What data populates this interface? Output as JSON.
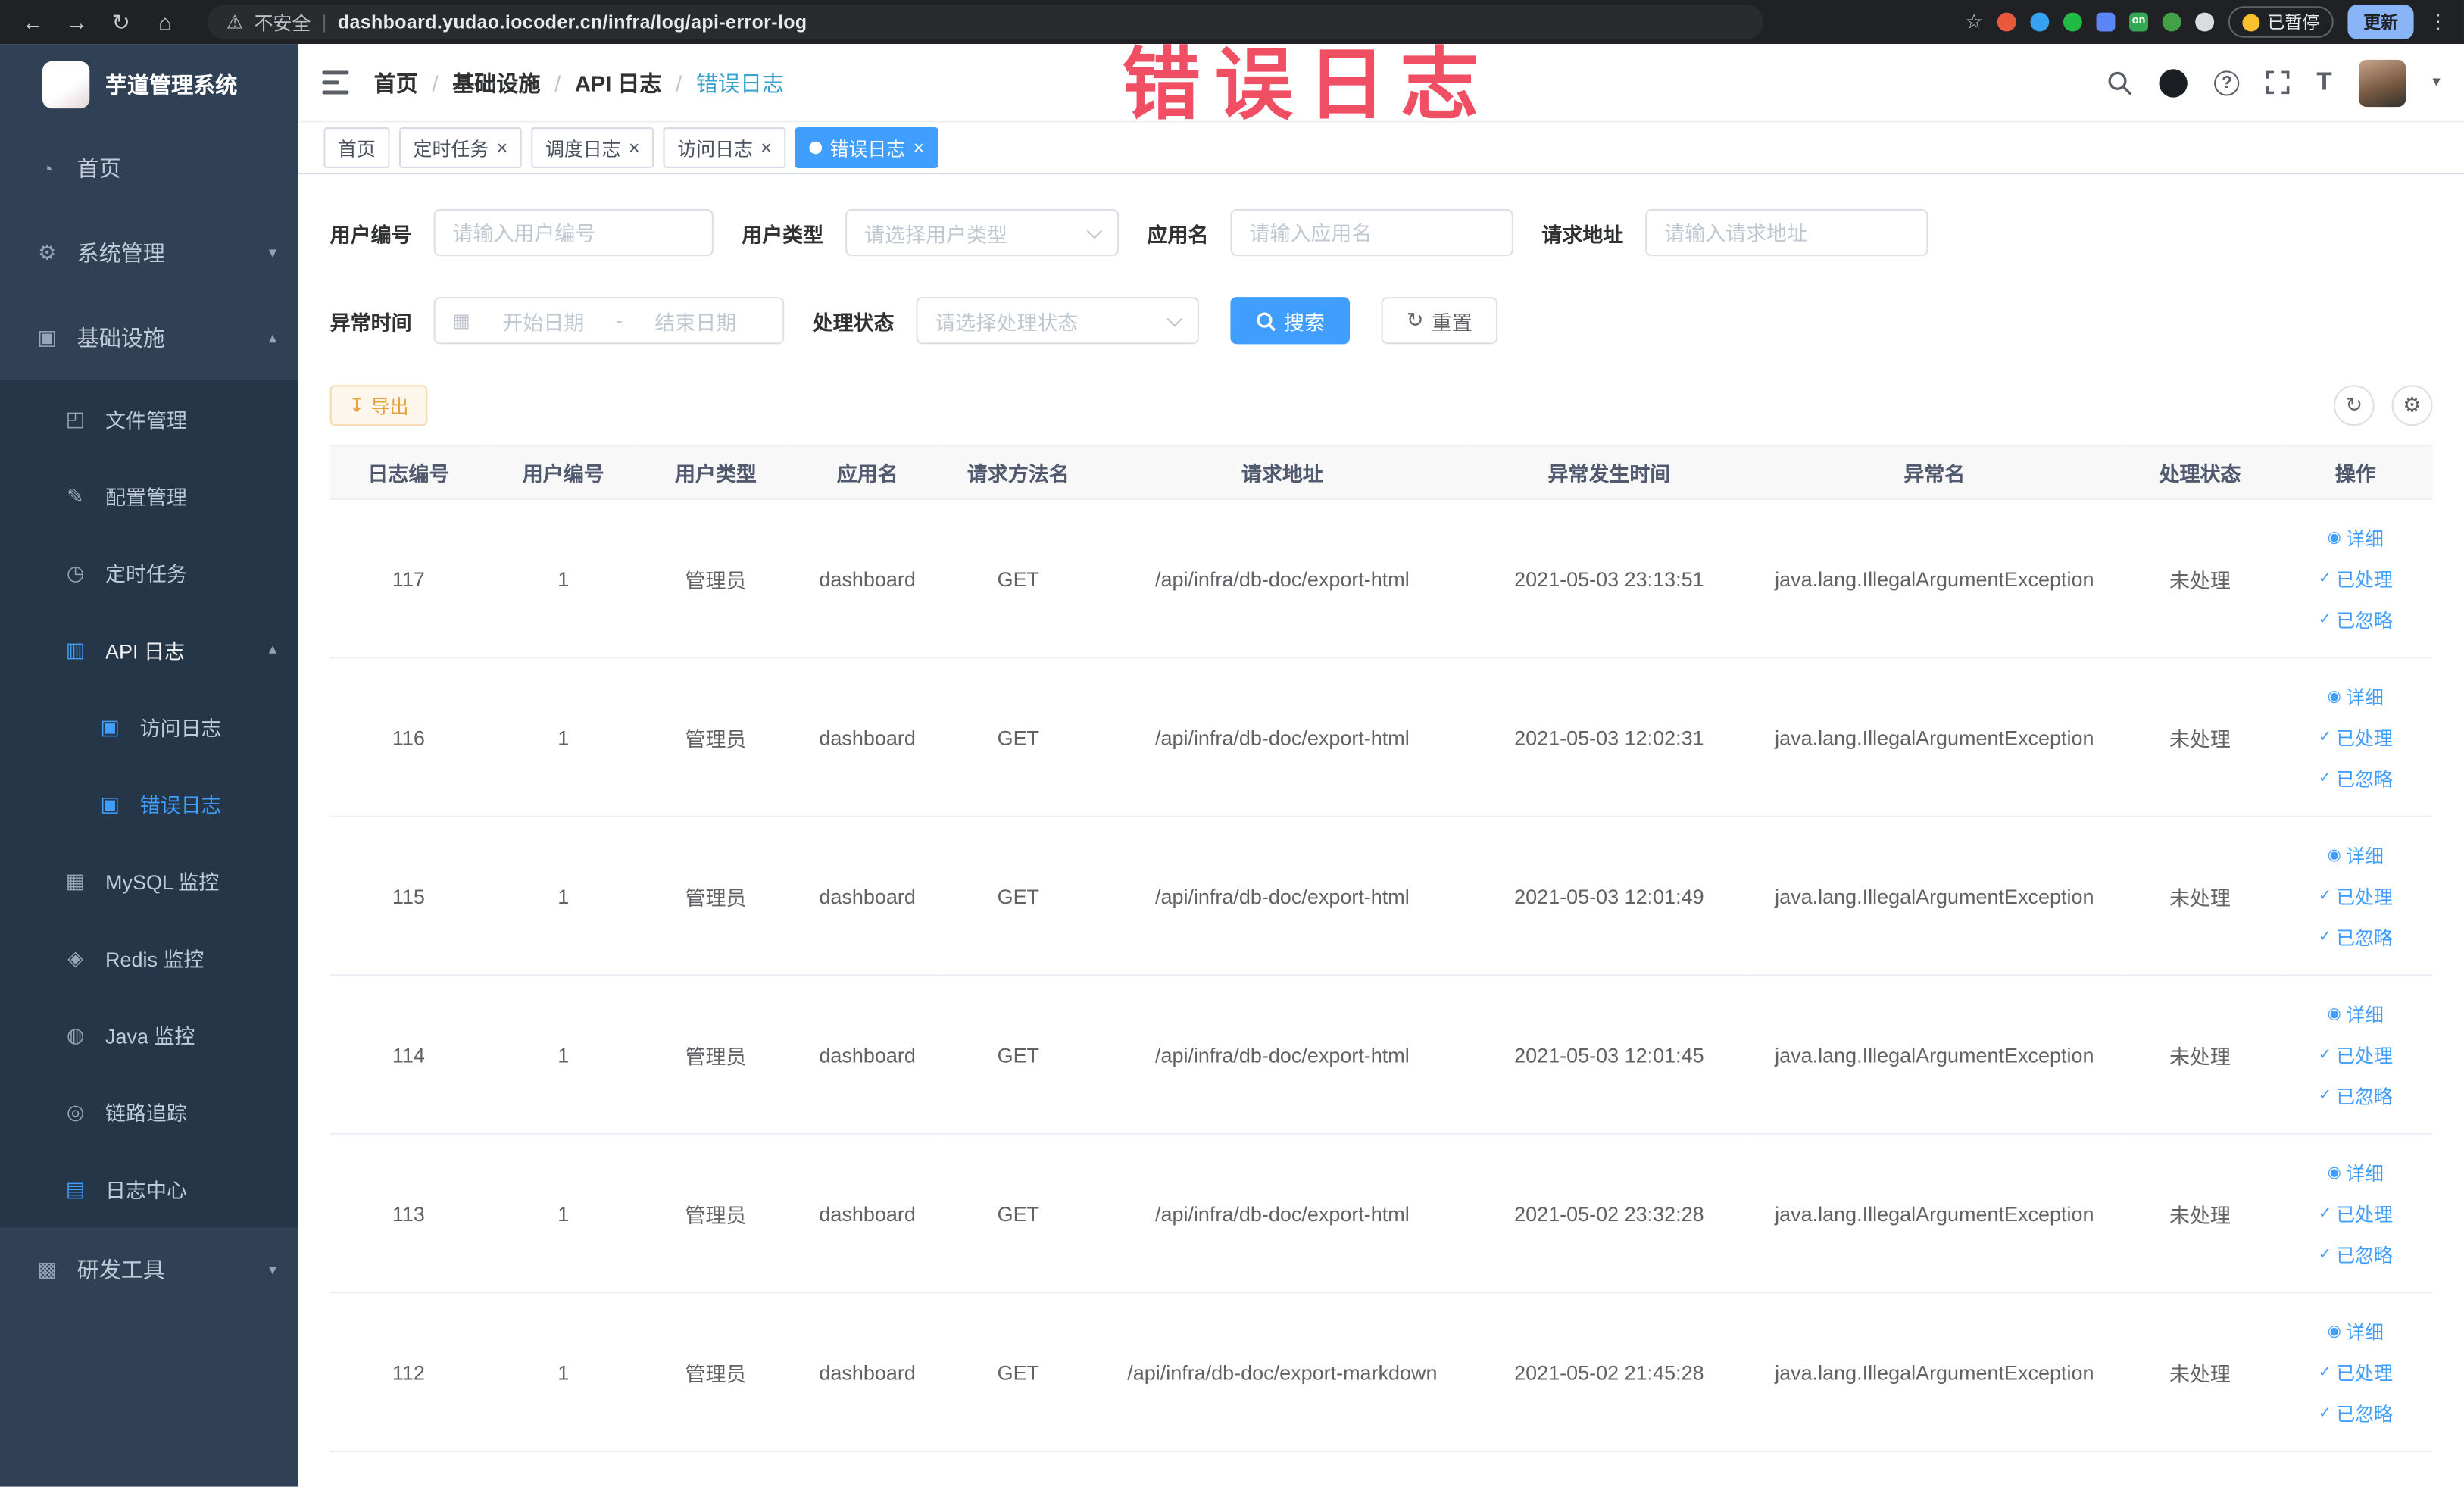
{
  "browser": {
    "security_label": "不安全",
    "url": "dashboard.yudao.iocoder.cn/infra/log/api-error-log",
    "extension_on_badge": "on",
    "paused_label": "已暂停",
    "update_label": "更新"
  },
  "overlay": {
    "text": "错误日志",
    "color": "#ee4158"
  },
  "icons": {
    "back_arrow": "←",
    "forward_arrow": "→",
    "reload": "↻",
    "home": "⌂",
    "warning": "⚠",
    "star": "☆",
    "more_vertical": "⋮",
    "question_mark": "?",
    "caret_down": "▾",
    "chevron_down": "▾",
    "chevron_up": "▴",
    "close": "×",
    "check": "✓",
    "gear": "⚙",
    "refresh": "↻",
    "download": "↧",
    "font_size": "T",
    "eye": "◉",
    "calendar": "▦"
  },
  "sidebar": {
    "app_title": "芋道管理系统",
    "items": [
      {
        "label": "首页",
        "icon": "dashboard-icon",
        "glyph": "◔"
      },
      {
        "label": "系统管理",
        "icon": "gear-icon",
        "glyph": "⚙"
      },
      {
        "label": "基础设施",
        "icon": "infrastructure-icon",
        "glyph": "▣"
      },
      {
        "label": "文件管理",
        "icon": "file-manage-icon",
        "glyph": "◰"
      },
      {
        "label": "配置管理",
        "icon": "config-manage-icon",
        "glyph": "✎"
      },
      {
        "label": "定时任务",
        "icon": "scheduled-task-icon",
        "glyph": "◷"
      },
      {
        "label": "API 日志",
        "icon": "api-log-icon",
        "glyph": "▥"
      },
      {
        "label": "访问日志",
        "icon": "access-log-icon",
        "glyph": "▣"
      },
      {
        "label": "错误日志",
        "icon": "error-log-icon",
        "glyph": "▣"
      },
      {
        "label": "MySQL 监控",
        "icon": "mysql-monitor-icon",
        "glyph": "▦"
      },
      {
        "label": "Redis 监控",
        "icon": "redis-monitor-icon",
        "glyph": "◈"
      },
      {
        "label": "Java 监控",
        "icon": "java-monitor-icon",
        "glyph": "◍"
      },
      {
        "label": "链路追踪",
        "icon": "trace-icon",
        "glyph": "◎"
      },
      {
        "label": "日志中心",
        "icon": "log-center-icon",
        "glyph": "▤"
      },
      {
        "label": "研发工具",
        "icon": "dev-tools-icon",
        "glyph": "▩"
      }
    ]
  },
  "header": {
    "breadcrumb": [
      "首页",
      "基础设施",
      "API 日志",
      "错误日志"
    ],
    "separator": "/"
  },
  "tabs": [
    {
      "label": "首页"
    },
    {
      "label": "定时任务"
    },
    {
      "label": "调度日志"
    },
    {
      "label": "访问日志"
    },
    {
      "label": "错误日志"
    }
  ],
  "filters": {
    "user_id": {
      "label": "用户编号",
      "placeholder": "请输入用户编号"
    },
    "user_type": {
      "label": "用户类型",
      "placeholder": "请选择用户类型"
    },
    "app_name": {
      "label": "应用名",
      "placeholder": "请输入应用名"
    },
    "request_url": {
      "label": "请求地址",
      "placeholder": "请输入请求地址"
    },
    "exception_time": {
      "label": "异常时间",
      "start_placeholder": "开始日期",
      "separator": "-",
      "end_placeholder": "结束日期"
    },
    "process_status": {
      "label": "处理状态",
      "placeholder": "请选择处理状态"
    },
    "search_label": "搜索",
    "reset_label": "重置"
  },
  "toolbar": {
    "export_label": "导出"
  },
  "table": {
    "columns": [
      "日志编号",
      "用户编号",
      "用户类型",
      "应用名",
      "请求方法名",
      "请求地址",
      "异常发生时间",
      "异常名",
      "处理状态",
      "操作"
    ],
    "actions": {
      "detail": "详细",
      "processed": "已处理",
      "ignored": "已忽略"
    },
    "rows": [
      {
        "id": "117",
        "user_id": "1",
        "user_type": "管理员",
        "app": "dashboard",
        "method": "GET",
        "url": "/api/infra/db-doc/export-html",
        "time": "2021-05-03 23:13:51",
        "exception": "java.lang.IllegalArgumentException",
        "status": "未处理"
      },
      {
        "id": "116",
        "user_id": "1",
        "user_type": "管理员",
        "app": "dashboard",
        "method": "GET",
        "url": "/api/infra/db-doc/export-html",
        "time": "2021-05-03 12:02:31",
        "exception": "java.lang.IllegalArgumentException",
        "status": "未处理"
      },
      {
        "id": "115",
        "user_id": "1",
        "user_type": "管理员",
        "app": "dashboard",
        "method": "GET",
        "url": "/api/infra/db-doc/export-html",
        "time": "2021-05-03 12:01:49",
        "exception": "java.lang.IllegalArgumentException",
        "status": "未处理"
      },
      {
        "id": "114",
        "user_id": "1",
        "user_type": "管理员",
        "app": "dashboard",
        "method": "GET",
        "url": "/api/infra/db-doc/export-html",
        "time": "2021-05-03 12:01:45",
        "exception": "java.lang.IllegalArgumentException",
        "status": "未处理"
      },
      {
        "id": "113",
        "user_id": "1",
        "user_type": "管理员",
        "app": "dashboard",
        "method": "GET",
        "url": "/api/infra/db-doc/export-html",
        "time": "2021-05-02 23:32:28",
        "exception": "java.lang.IllegalArgumentException",
        "status": "未处理"
      },
      {
        "id": "112",
        "user_id": "1",
        "user_type": "管理员",
        "app": "dashboard",
        "method": "GET",
        "url": "/api/infra/db-doc/export-markdown",
        "time": "2021-05-02 21:45:28",
        "exception": "java.lang.IllegalArgumentException",
        "status": "未处理"
      }
    ]
  },
  "theme": {
    "primary": "#409eff",
    "sidebar_bg": "#304156",
    "submenu_bg": "#253649",
    "export_color": "#e6a23c"
  }
}
